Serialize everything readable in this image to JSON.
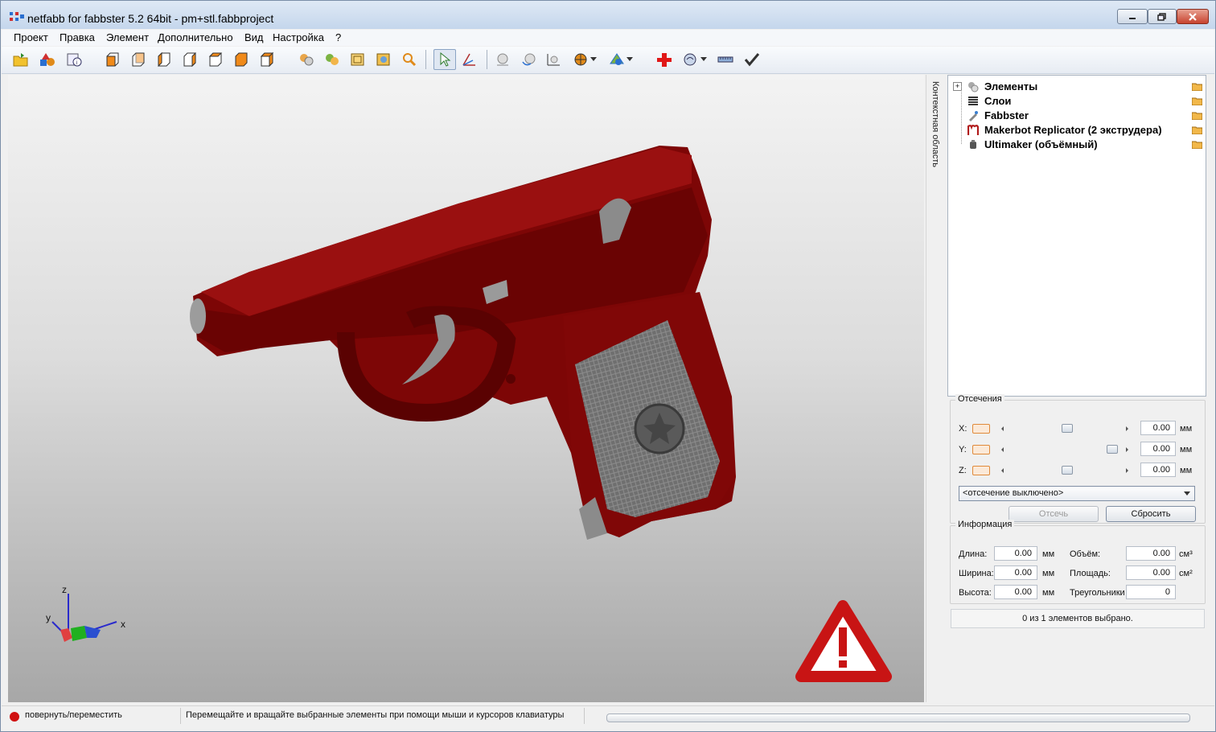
{
  "window": {
    "title": "netfabb for fabbster 5.2 64bit - pm+stl.fabbproject"
  },
  "menu": [
    "Проект",
    "Правка",
    "Элемент",
    "Дополнительно",
    "Вид",
    "Настройка",
    "?"
  ],
  "toolbar": {
    "icons": [
      "open-project-icon",
      "add-part-icon",
      "part-info-icon",
      "view-front-icon",
      "view-back-icon",
      "view-left-icon",
      "view-right-icon",
      "view-top-icon",
      "view-bottom-icon",
      "view-perspective-icon",
      "render-mode-icon",
      "shading-icon",
      "wireframe-icon",
      "box-view-icon",
      "zoom-icon",
      "select-arrow-icon",
      "move-axis-icon",
      "sphere-icon",
      "rotate-icon",
      "scale-icon",
      "section-icon",
      "color-mode-icon",
      "repair-cross-icon",
      "measure-icon",
      "ruler-icon",
      "checkmark-icon"
    ]
  },
  "context_strip": {
    "label": "Контекстная область"
  },
  "tree": {
    "items": [
      {
        "label": "Элементы",
        "icon": "parts-spheres-icon"
      },
      {
        "label": "Слои",
        "icon": "layers-icon"
      },
      {
        "label": "Fabbster",
        "icon": "fabbster-printer-icon"
      },
      {
        "label": "Makerbot Replicator (2 экструдера)",
        "icon": "makerbot-icon"
      },
      {
        "label": "Ultimaker (объёмный)",
        "icon": "ultimaker-icon"
      }
    ]
  },
  "clipping": {
    "title": "Отсечения",
    "axes": [
      {
        "label": "X:",
        "value": "0.00",
        "unit": "мм",
        "position": 0.5
      },
      {
        "label": "Y:",
        "value": "0.00",
        "unit": "мм",
        "position": 0.9
      },
      {
        "label": "Z:",
        "value": "0.00",
        "unit": "мм",
        "position": 0.5
      }
    ],
    "mode_select": "<отсечение выключено>",
    "cut_button": "Отсечь",
    "reset_button": "Сбросить"
  },
  "info": {
    "title": "Информация",
    "length_label": "Длина:",
    "length_value": "0.00",
    "length_unit": "мм",
    "width_label": "Ширина:",
    "width_value": "0.00",
    "width_unit": "мм",
    "height_label": "Высота:",
    "height_value": "0.00",
    "height_unit": "мм",
    "volume_label": "Объём:",
    "volume_value": "0.00",
    "volume_unit": "см³",
    "area_label": "Площадь:",
    "area_value": "0.00",
    "area_unit": "см²",
    "triangles_label": "Треугольники",
    "triangles_value": "0"
  },
  "selection_status": "0 из 1 элементов выбрано.",
  "axes_gizmo": {
    "x": "x",
    "y": "y",
    "z": "z"
  },
  "statusbar": {
    "mode": "повернуть/переместить",
    "hint": "Перемещайте и вращайте выбранные элементы при помощи мыши и курсоров клавиатуры"
  },
  "colors": {
    "model": "#8b0a0a",
    "warning": "#c81414",
    "accent": "#e08a3a"
  }
}
